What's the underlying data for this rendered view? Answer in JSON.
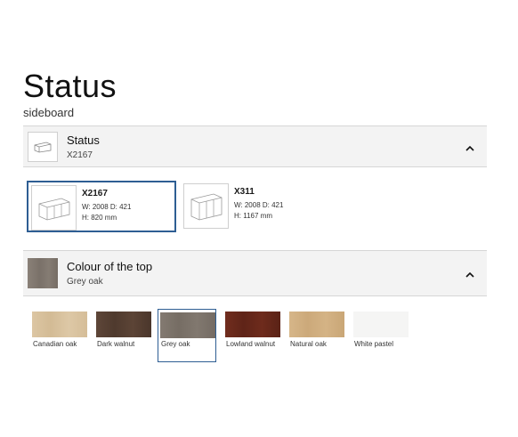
{
  "header": {
    "title": "Status",
    "subtitle": "sideboard"
  },
  "model_section": {
    "title": "Status",
    "selected_code": "X2167",
    "icon": "sideboard-icon",
    "toggle_icon": "chevron-up-icon"
  },
  "model_options": [
    {
      "name": "X2167",
      "dims_line1": "W: 2008 D: 421",
      "dims_line2": "H: 820 mm",
      "selected": true
    },
    {
      "name": "X311",
      "dims_line1": "W: 2008 D: 421",
      "dims_line2": "H: 1167 mm",
      "selected": false
    }
  ],
  "colour_section": {
    "title": "Colour of the top",
    "selected_colour": "Grey oak",
    "toggle_icon": "chevron-up-icon"
  },
  "colours": [
    {
      "name": "Canadian oak",
      "color": "#d9c3a0",
      "selected": false
    },
    {
      "name": "Dark walnut",
      "color": "#5a4336",
      "selected": false
    },
    {
      "name": "Grey oak",
      "color": "#7d746b",
      "selected": true
    },
    {
      "name": "Lowland walnut",
      "color": "#6b2a1c",
      "selected": false
    },
    {
      "name": "Natural oak",
      "color": "#d2b285",
      "selected": false
    },
    {
      "name": "White pastel",
      "color": "#f4f4f3",
      "selected": false
    }
  ],
  "colours_accent": {
    "selection_border": "#2e5e93"
  }
}
